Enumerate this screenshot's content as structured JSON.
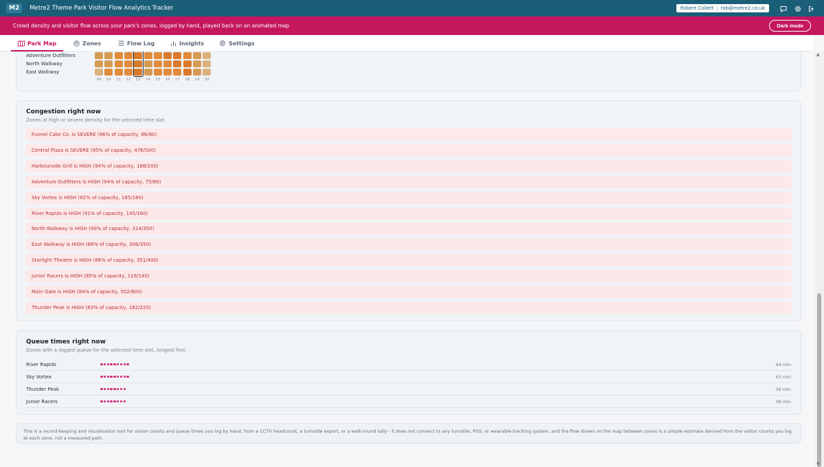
{
  "app": {
    "logo": "M2",
    "title": "Metre2 Theme Park Visitor Flow Analytics Tracker",
    "user_name": "Robert Collett",
    "user_email": "rob@metre2.co.uk"
  },
  "banner": {
    "text": "Crowd density and visitor flow across your park's zones, logged by hand, played back on an animated map",
    "dark_mode_label": "Dark mode"
  },
  "tabs": [
    {
      "label": "Park Map",
      "icon": "map-icon",
      "active": true
    },
    {
      "label": "Zones",
      "icon": "pin-icon",
      "active": false
    },
    {
      "label": "Flow Log",
      "icon": "list-icon",
      "active": false
    },
    {
      "label": "Insights",
      "icon": "bar-chart-icon",
      "active": false
    },
    {
      "label": "Settings",
      "icon": "gear-icon",
      "active": false
    }
  ],
  "heatmap": {
    "hours": [
      "09",
      "10",
      "11",
      "12",
      "13",
      "14",
      "15",
      "16",
      "17",
      "18",
      "19",
      "20"
    ],
    "selected_hour": "13",
    "rows": [
      {
        "label": "Adventure Outfitters",
        "levels": [
          2,
          2,
          3,
          3,
          4,
          3,
          3,
          4,
          4,
          3,
          2,
          1
        ]
      },
      {
        "label": "North Walkway",
        "levels": [
          2,
          2,
          3,
          3,
          4,
          2,
          3,
          3,
          4,
          4,
          2,
          1
        ]
      },
      {
        "label": "East Walkway",
        "levels": [
          1,
          3,
          3,
          3,
          4,
          2,
          3,
          3,
          3,
          4,
          2,
          1
        ]
      }
    ],
    "top_row_levels": [
      1,
      2,
      3,
      3,
      4,
      2,
      3,
      3,
      4,
      3,
      2,
      1
    ],
    "level_colors": [
      "#a8d4c2",
      "#d9b27c",
      "#d49a52",
      "#e08a3a",
      "#d9792b"
    ]
  },
  "congestion": {
    "title": "Congestion right now",
    "subtitle": "Zones at high or severe density for the selected time slot.",
    "alerts": [
      "Funnel Cake Co. is SEVERE (96% of capacity, 86/90)",
      "Central Plaza is SEVERE (95% of capacity, 476/500)",
      "Harbourside Grill is HIGH (94% of capacity, 188/200)",
      "Adventure Outfitters is HIGH (94% of capacity, 75/80)",
      "Sky Vortex is HIGH (92% of capacity, 165/180)",
      "River Rapids is HIGH (91% of capacity, 145/160)",
      "North Walkway is HIGH (90% of capacity, 314/350)",
      "East Walkway is HIGH (88% of capacity, 308/350)",
      "Starlight Theatre is HIGH (88% of capacity, 351/400)",
      "Junior Racers is HIGH (85% of capacity, 119/140)",
      "Main Gate is HIGH (84% of capacity, 502/600)",
      "Thunder Peak is HIGH (83% of capacity, 182/220)"
    ]
  },
  "queues": {
    "title": "Queue times right now",
    "subtitle": "Zones with a logged queue for the selected time slot, longest first.",
    "rows": [
      {
        "name": "River Rapids",
        "minutes": 44,
        "label": "44 min"
      },
      {
        "name": "Sky Vortex",
        "minutes": 43,
        "label": "43 min"
      },
      {
        "name": "Thunder Peak",
        "minutes": 39,
        "label": "39 min"
      },
      {
        "name": "Junior Racers",
        "minutes": 38,
        "label": "38 min"
      }
    ]
  },
  "footer_note": "This is a record-keeping and visualisation tool for visitor counts and queue times you log by hand, from a CCTV headcount, a turnstile export, or a walk-round tally - it does not connect to any turnstile, POS, or wearable-tracking system, and the flow shown on the map between zones is a simple estimate derived from the visitor counts you log at each zone, not a measured path."
}
